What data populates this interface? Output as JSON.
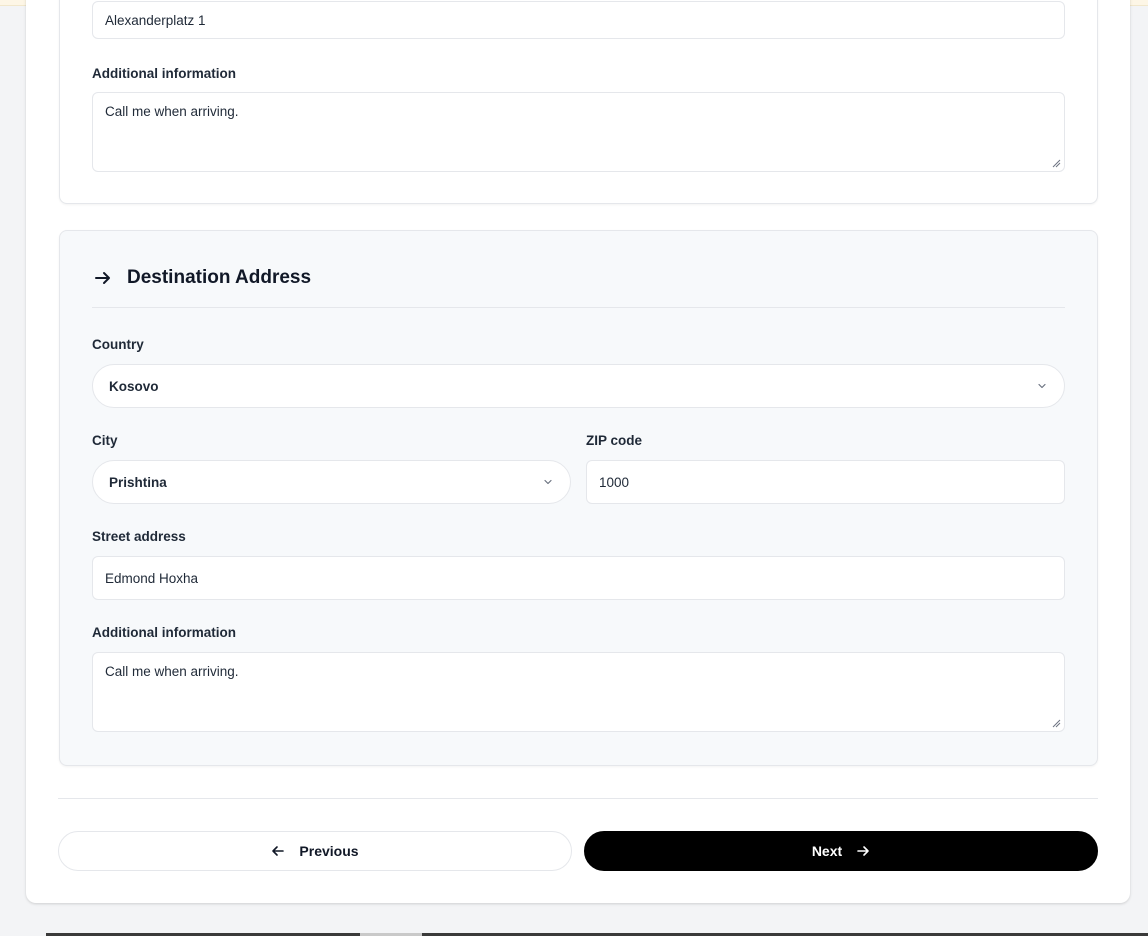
{
  "origin": {
    "street_value": "Alexanderplatz 1",
    "additional_label": "Additional information",
    "additional_value": "Call me when arriving."
  },
  "destination": {
    "title": "Destination Address",
    "country_label": "Country",
    "country_value": "Kosovo",
    "city_label": "City",
    "city_value": "Prishtina",
    "zip_label": "ZIP code",
    "zip_value": "1000",
    "street_label": "Street address",
    "street_value": "Edmond Hoxha",
    "additional_label": "Additional information",
    "additional_value": "Call me when arriving."
  },
  "nav": {
    "previous_label": "Previous",
    "next_label": "Next"
  },
  "colors": {
    "primary_button": "#000000",
    "section_bg": "#f7f9fb",
    "page_bg": "#f3f4f6"
  },
  "icons": [
    "arrow-right-icon",
    "chevron-down-icon",
    "arrow-left-icon",
    "resize-grip-icon"
  ]
}
